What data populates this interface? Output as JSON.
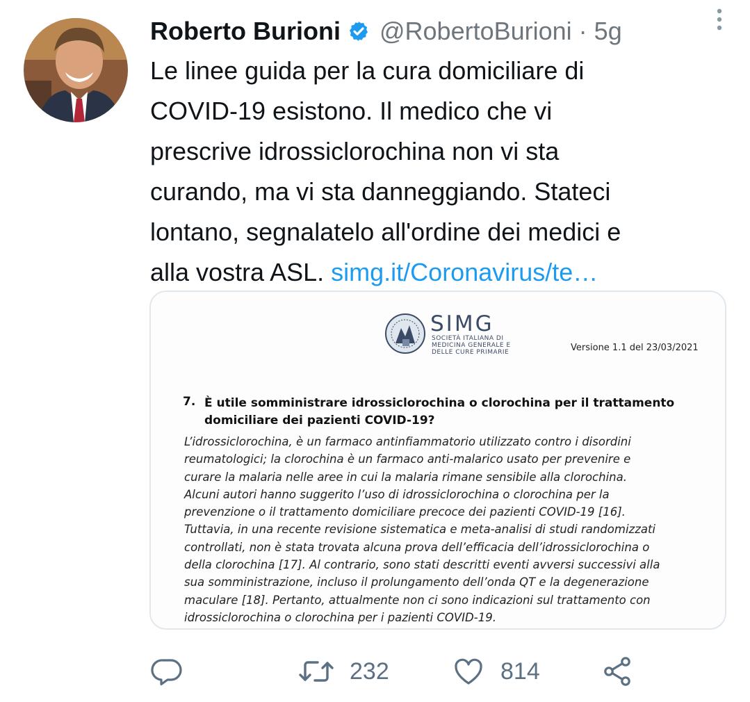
{
  "author": {
    "name": "Roberto Burioni",
    "handle": "@RobertoBurioni",
    "separator": "·",
    "time": "5g"
  },
  "tweet": {
    "lines": [
      "Le linee guida per la cura domiciliare di",
      "COVID-19 esistono. Il medico che vi",
      "prescrive idrossiclorochina non vi sta",
      "curando, ma vi sta danneggiando. Stateci",
      "lontano, segnalatelo all'ordine dei medici e"
    ],
    "last_line_text": "alla vostra ASL.",
    "link": "simg.it/Coronavirus/te…"
  },
  "media": {
    "org_name": "SIMG",
    "org_subtitle": "Società Italiana di Medicina Generale e delle Cure Primarie",
    "version": "Versione 1.1 del 23/03/2021",
    "question_number": "7.",
    "question_title": "È utile somministrare idrossiclorochina o clorochina per il trattamento domiciliare dei pazienti COVID-19?",
    "body_lines": [
      "L’idrossiclorochina, è un farmaco antinfiammatorio utilizzato contro i disordini",
      "reumatologici; la clorochina è un farmaco anti-malarico usato per prevenire e",
      "curare la malaria nelle aree in cui la malaria rimane sensibile alla clorochina.",
      "Alcuni autori hanno suggerito l’uso di idrossiclorochina o clorochina per la",
      "prevenzione o il trattamento domiciliare precoce dei pazienti COVID-19 [16].",
      "Tuttavia, in una recente revisione sistematica e meta-analisi di studi randomizzati",
      "controllati, non è stata trovata alcuna prova dell’efficacia dell’idrossiclorochina o",
      "della clorochina [17]. Al contrario, sono stati descritti eventi avversi successivi alla",
      "sua somministrazione, incluso il prolungamento dell’onda QT e la degenerazione",
      "maculare [18]. Pertanto, attualmente non ci sono indicazioni sul trattamento con",
      "idrossiclorochina o clorochina per i pazienti COVID-19."
    ]
  },
  "actions": {
    "retweets": "232",
    "likes": "814"
  },
  "icons": {
    "verified": "verified-badge-icon",
    "more": "more-vertical-icon",
    "reply": "reply-icon",
    "retweet": "retweet-icon",
    "like": "heart-icon",
    "share": "share-icon"
  },
  "colors": {
    "text": "#0f1419",
    "secondary": "#6e767d",
    "link": "#1d9bf0",
    "action": "#5b7083"
  }
}
